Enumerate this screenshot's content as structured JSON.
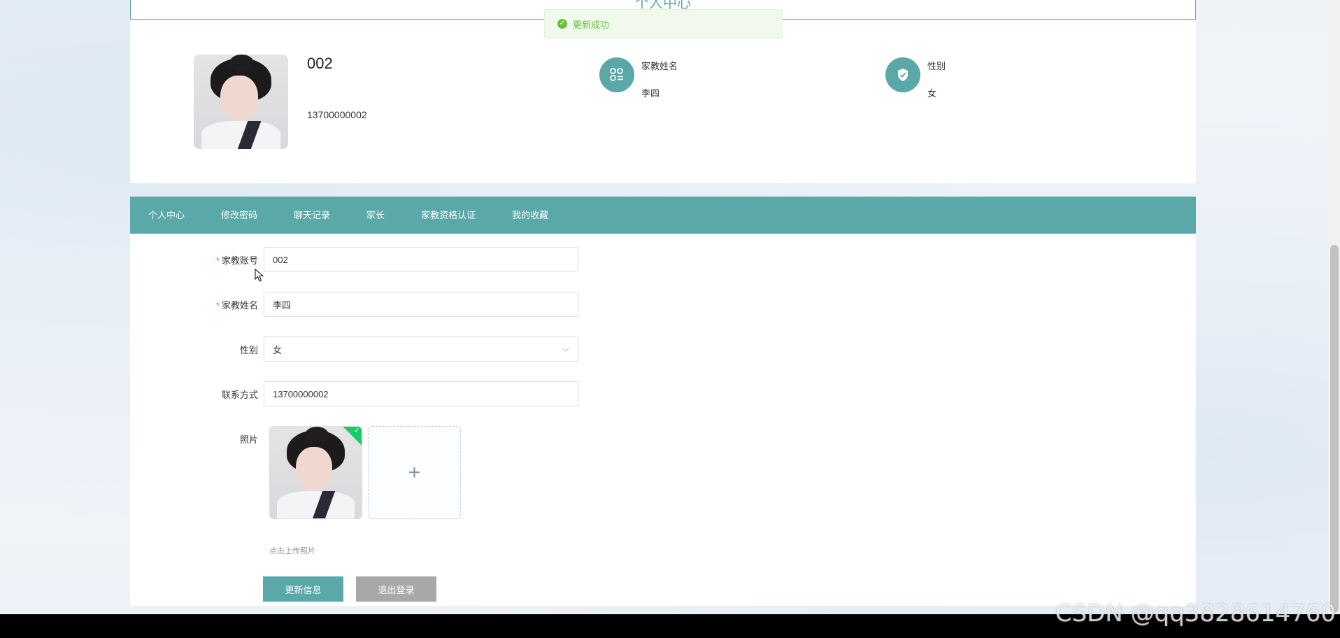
{
  "header": {
    "title": "个人中心"
  },
  "toast": {
    "message": "更新成功"
  },
  "profile": {
    "account": "002",
    "phone": "13700000002",
    "name_label": "家教姓名",
    "name_value": "李四",
    "gender_label": "性别",
    "gender_value": "女"
  },
  "tabs": [
    {
      "label": "个人中心"
    },
    {
      "label": "修改密码"
    },
    {
      "label": "聊天记录"
    },
    {
      "label": "家长"
    },
    {
      "label": "家教资格认证"
    },
    {
      "label": "我的收藏"
    }
  ],
  "form": {
    "account_label": "家教账号",
    "account_value": "002",
    "name_label": "家教姓名",
    "name_value": "李四",
    "gender_label": "性别",
    "gender_value": "女",
    "phone_label": "联系方式",
    "phone_value": "13700000002",
    "photo_label": "照片",
    "upload_tip": "点击上传照片",
    "required_mark": "*",
    "add_glyph": "+"
  },
  "buttons": {
    "update": "更新信息",
    "logout": "退出登录"
  },
  "watermark": "CSDN @qq3828614760",
  "colors": {
    "accent": "#5aa8a7",
    "success": "#67c23a",
    "required": "#f56c6c",
    "logout_button": "#a8a8a8"
  },
  "icons": {
    "name_icon": "grid-list-icon",
    "gender_icon": "shield-check-icon",
    "toast_icon": "check-circle-icon",
    "select_icon": "chevron-down-icon",
    "upload_icon": "plus-icon"
  }
}
